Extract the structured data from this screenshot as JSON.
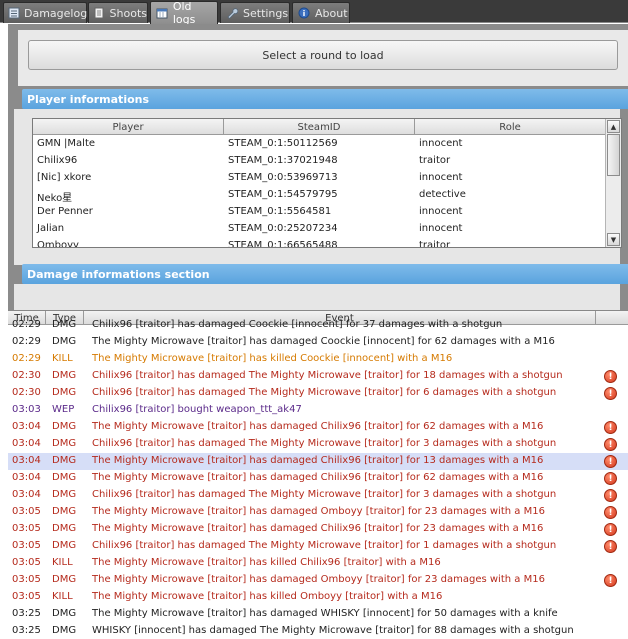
{
  "colors": {
    "accent": "#6fb0e6",
    "dmg_red": "#b52a1c",
    "kill_orange": "#d67a00",
    "wep_purple": "#5b2a8a",
    "normal": "#222222",
    "selected": "#d6def7"
  },
  "tabs": [
    {
      "label": "Damagelog",
      "icon": "list-icon",
      "active": false
    },
    {
      "label": "Shoots",
      "icon": "document-icon",
      "active": false
    },
    {
      "label": "Old logs",
      "icon": "calendar-icon",
      "active": true
    },
    {
      "label": "Settings",
      "icon": "wrench-icon",
      "active": false
    },
    {
      "label": "About",
      "icon": "info-icon",
      "active": false
    }
  ],
  "load_button": "Select a round to load",
  "player_section": {
    "title": "Player informations",
    "columns": [
      "Player",
      "SteamID",
      "Role"
    ],
    "rows": [
      [
        "GMN |Malte",
        "STEAM_0:1:50112569",
        "innocent"
      ],
      [
        "Chilix96",
        "STEAM_0:1:37021948",
        "traitor"
      ],
      [
        "[Nic] xkore",
        "STEAM_0:0:53969713",
        "innocent"
      ],
      [
        "Neko星",
        "STEAM_0:1:54579795",
        "detective"
      ],
      [
        "Der Penner",
        "STEAM_0:1:5564581",
        "innocent"
      ],
      [
        "Jalian",
        "STEAM_0:0:25207234",
        "innocent"
      ],
      [
        "Omboyy",
        "STEAM_0:1:66565488",
        "traitor"
      ]
    ]
  },
  "damage_section": {
    "title": "Damage informations section"
  },
  "damage_log": {
    "columns": [
      "Time",
      "Type",
      "Event"
    ],
    "rows": [
      {
        "time": "02:29",
        "type": "DMG",
        "event": "Chilix96 [traitor] has damaged Coockie [innocent] for 37 damages with a shotgun",
        "style": "normal",
        "warn": false
      },
      {
        "time": "02:29",
        "type": "DMG",
        "event": "The Mighty Microwave [traitor] has damaged Coockie [innocent] for 62 damages with a M16",
        "style": "normal",
        "warn": false
      },
      {
        "time": "02:29",
        "type": "KILL",
        "event": "The Mighty Microwave [traitor] has killed Coockie [innocent] with a M16",
        "style": "kill",
        "warn": false
      },
      {
        "time": "02:30",
        "type": "DMG",
        "event": "Chilix96 [traitor] has damaged The Mighty Microwave [traitor] for 18 damages with a shotgun",
        "style": "dmg",
        "warn": true
      },
      {
        "time": "02:30",
        "type": "DMG",
        "event": "Chilix96 [traitor] has damaged The Mighty Microwave [traitor] for 6 damages with a shotgun",
        "style": "dmg",
        "warn": true
      },
      {
        "time": "03:03",
        "type": "WEP",
        "event": "Chilix96 [traitor] bought weapon_ttt_ak47",
        "style": "wep",
        "warn": false
      },
      {
        "time": "03:04",
        "type": "DMG",
        "event": "The Mighty Microwave [traitor] has damaged Chilix96 [traitor] for 62 damages with a M16",
        "style": "dmg",
        "warn": true
      },
      {
        "time": "03:04",
        "type": "DMG",
        "event": "Chilix96 [traitor] has damaged The Mighty Microwave [traitor] for 3 damages with a shotgun",
        "style": "dmg",
        "warn": true
      },
      {
        "time": "03:04",
        "type": "DMG",
        "event": "The Mighty Microwave [traitor] has damaged Chilix96 [traitor] for 13 damages with a M16",
        "style": "dmg",
        "warn": true,
        "selected": true
      },
      {
        "time": "03:04",
        "type": "DMG",
        "event": "The Mighty Microwave [traitor] has damaged Chilix96 [traitor] for 62 damages with a M16",
        "style": "dmg",
        "warn": true
      },
      {
        "time": "03:04",
        "type": "DMG",
        "event": "Chilix96 [traitor] has damaged The Mighty Microwave [traitor] for 3 damages with a shotgun",
        "style": "dmg",
        "warn": true
      },
      {
        "time": "03:05",
        "type": "DMG",
        "event": "The Mighty Microwave [traitor] has damaged Omboyy [traitor] for 23 damages with a M16",
        "style": "dmg",
        "warn": true
      },
      {
        "time": "03:05",
        "type": "DMG",
        "event": "The Mighty Microwave [traitor] has damaged Chilix96 [traitor] for 23 damages with a M16",
        "style": "dmg",
        "warn": true
      },
      {
        "time": "03:05",
        "type": "DMG",
        "event": "Chilix96 [traitor] has damaged The Mighty Microwave [traitor] for 1 damages with a shotgun",
        "style": "dmg",
        "warn": true
      },
      {
        "time": "03:05",
        "type": "KILL",
        "event": "The Mighty Microwave [traitor] has killed Chilix96 [traitor] with a M16",
        "style": "dmg",
        "warn": false
      },
      {
        "time": "03:05",
        "type": "DMG",
        "event": "The Mighty Microwave [traitor] has damaged Omboyy [traitor] for 23 damages with a M16",
        "style": "dmg",
        "warn": true
      },
      {
        "time": "03:05",
        "type": "KILL",
        "event": "The Mighty Microwave [traitor] has killed Omboyy [traitor] with a M16",
        "style": "dmg",
        "warn": false
      },
      {
        "time": "03:25",
        "type": "DMG",
        "event": "The Mighty Microwave [traitor] has damaged WHISKY [innocent] for 50 damages with a knife",
        "style": "normal",
        "warn": false
      },
      {
        "time": "03:25",
        "type": "DMG",
        "event": "WHISKY [innocent] has damaged The Mighty Microwave [traitor] for 88 damages with a shotgun",
        "style": "normal",
        "warn": false
      }
    ]
  }
}
